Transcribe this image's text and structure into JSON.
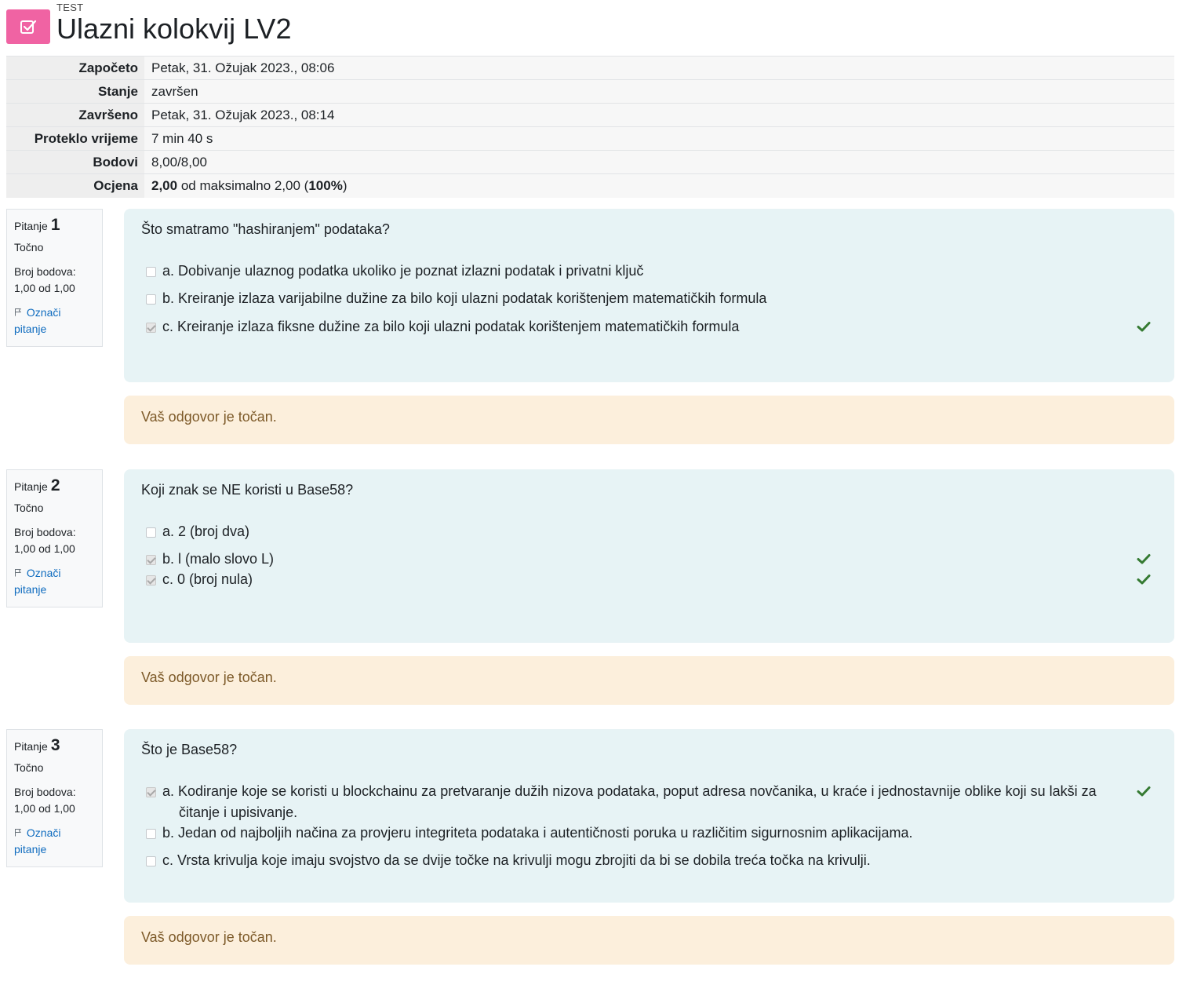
{
  "header": {
    "kind": "TEST",
    "title": "Ulazni kolokvij LV2",
    "icon": "quiz-checkbox-icon"
  },
  "summary": {
    "rows": [
      {
        "label": "Započeto",
        "value": "Petak, 31. Ožujak 2023., 08:06"
      },
      {
        "label": "Stanje",
        "value": "završen"
      },
      {
        "label": "Završeno",
        "value": "Petak, 31. Ožujak 2023., 08:14"
      },
      {
        "label": "Proteklo vrijeme",
        "value": "7 min 40 s"
      },
      {
        "label": "Bodovi",
        "value": "8,00/8,00"
      }
    ],
    "grade": {
      "label": "Ocjena",
      "score": "2,00",
      "middle": " od maksimalno 2,00 (",
      "percent": "100%",
      "end": ")"
    }
  },
  "questions": [
    {
      "label": "Pitanje",
      "number": "1",
      "state": "Točno",
      "grade_label": "Broj bodova:",
      "grade_value": "1,00 od 1,00",
      "flag_line1": "Označi",
      "flag_line2": "pitanje",
      "text": "Što smatramo \"hashiranjem\" podataka?",
      "answers": [
        {
          "text": "a. Dobivanje ulaznog podatka ukoliko je poznat izlazni podatak i privatni ključ",
          "checked": false,
          "correct": false
        },
        {
          "text": "b. Kreiranje izlaza varijabilne dužine za bilo koji ulazni podatak korištenjem matematičkih formula",
          "checked": false,
          "correct": false
        },
        {
          "text": "c. Kreiranje izlaza fiksne dužine za bilo koji ulazni podatak korištenjem matematičkih formula",
          "checked": true,
          "correct": true
        }
      ],
      "feedback": "Vaš odgovor je točan."
    },
    {
      "label": "Pitanje",
      "number": "2",
      "state": "Točno",
      "grade_label": "Broj bodova:",
      "grade_value": "1,00 od 1,00",
      "flag_line1": "Označi",
      "flag_line2": "pitanje",
      "text": "Koji znak se NE koristi u Base58?",
      "answers": [
        {
          "text": "a. 2 (broj dva)",
          "checked": false,
          "correct": false
        },
        {
          "text": "b. l (malo slovo L)",
          "checked": true,
          "correct": true
        },
        {
          "text": "c. 0 (broj nula)",
          "checked": true,
          "correct": true
        }
      ],
      "feedback": "Vaš odgovor je točan."
    },
    {
      "label": "Pitanje",
      "number": "3",
      "state": "Točno",
      "grade_label": "Broj bodova:",
      "grade_value": "1,00 od 1,00",
      "flag_line1": "Označi",
      "flag_line2": "pitanje",
      "text": "Što je Base58?",
      "answers": [
        {
          "text": "a. Kodiranje koje se koristi u blockchainu za pretvaranje dužih nizova podataka, poput adresa novčanika, u kraće i jednostavnije oblike koji su lakši za",
          "text_cont": "čitanje i upisivanje.",
          "checked": true,
          "correct": true
        },
        {
          "text": "b. Jedan od najboljih načina za provjeru integriteta podataka i autentičnosti poruka u različitim sigurnosnim aplikacijama.",
          "checked": false,
          "correct": false
        },
        {
          "text": "c. Vrsta krivulja koje imaju svojstvo da se dvije točke na krivulji mogu zbrojiti da bi se dobila treća točka na krivulji.",
          "checked": false,
          "correct": false
        }
      ],
      "feedback": "Vaš odgovor je točan."
    }
  ],
  "colors": {
    "icon_bg": "#f063a3",
    "formulation_bg": "#e7f3f5",
    "feedback_bg": "#fcefdc",
    "feedback_text": "#7d5a29",
    "link": "#0f6cbf",
    "correct_tick": "#357a32"
  }
}
